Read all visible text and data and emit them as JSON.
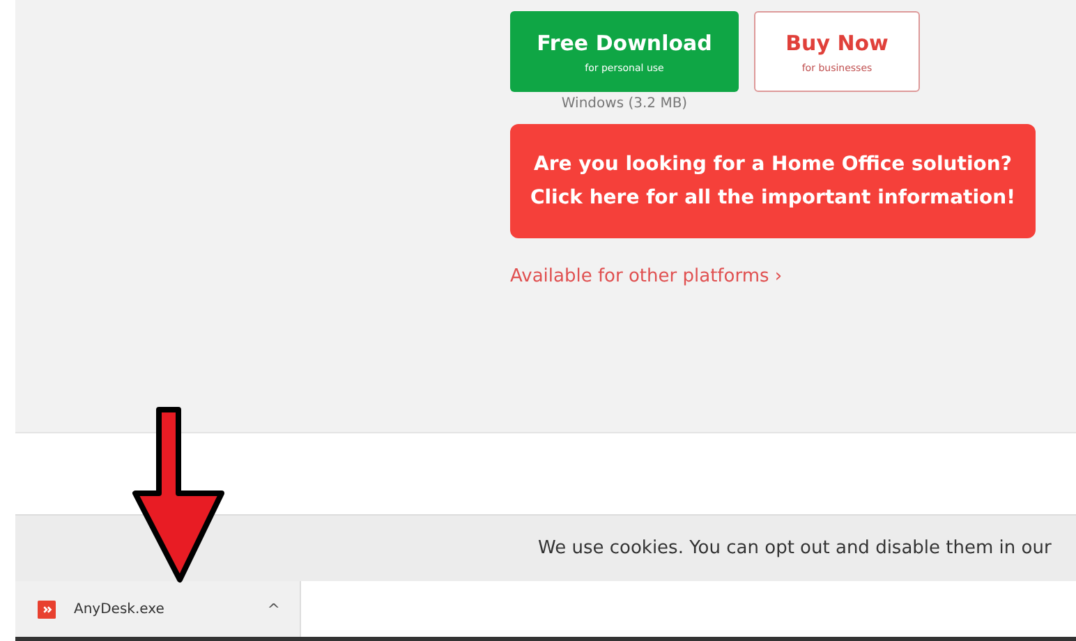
{
  "hero": {
    "download_button": {
      "label": "Free Download",
      "sublabel": "for personal use"
    },
    "buy_button": {
      "label": "Buy Now",
      "sublabel": "for businesses"
    },
    "download_note": "Windows (3.2 MB)",
    "banner": {
      "line_1": "Are you looking for a Home Office solution?",
      "line_2": "Click here for all the important information!"
    },
    "platforms_link": "Available for other platforms ›"
  },
  "cookie_bar": {
    "text": "We use cookies. You can opt out and disable them in our"
  },
  "download_bar": {
    "items": [
      {
        "file_name": "AnyDesk.exe",
        "caret": "^"
      }
    ]
  }
}
